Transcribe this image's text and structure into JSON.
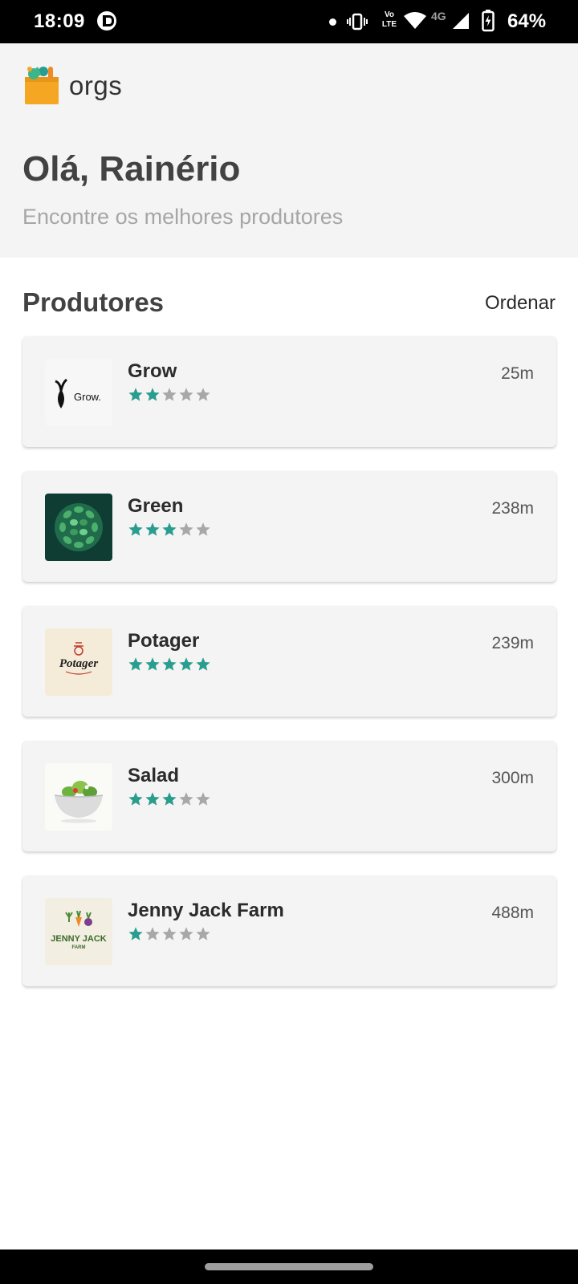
{
  "status_bar": {
    "time": "18:09",
    "battery": "64%",
    "network": "4G",
    "volte_top": "Vo",
    "volte_bottom": "LTE",
    "icons": [
      "app-notification-icon",
      "notification-dot-icon",
      "vibrate-icon",
      "volte-icon",
      "wifi-icon",
      "signal-icon",
      "battery-charging-icon"
    ]
  },
  "header": {
    "brand": "orgs",
    "greeting": "Olá, Rainério",
    "subtitle": "Encontre os melhores produtores"
  },
  "section": {
    "title": "Produtores",
    "sort_label": "Ordenar"
  },
  "colors": {
    "star_active": "#2a9d8f",
    "star_inactive": "#a8a8a8",
    "header_bg": "#f4f4f4",
    "card_bg": "#f4f4f4"
  },
  "producers": [
    {
      "name": "Grow",
      "distance": "25m",
      "rating": 2,
      "logo": "grow-logo",
      "logo_text": "Grow."
    },
    {
      "name": "Green",
      "distance": "238m",
      "rating": 3,
      "logo": "green-leaves-logo"
    },
    {
      "name": "Potager",
      "distance": "239m",
      "rating": 5,
      "logo": "potager-logo",
      "logo_text": "Potager"
    },
    {
      "name": "Salad",
      "distance": "300m",
      "rating": 3,
      "logo": "salad-bowl-logo"
    },
    {
      "name": "Jenny Jack Farm",
      "distance": "488m",
      "rating": 1,
      "logo": "jenny-jack-farm-logo",
      "logo_text": "JENNY JACK",
      "logo_subtext": "FARM"
    }
  ]
}
